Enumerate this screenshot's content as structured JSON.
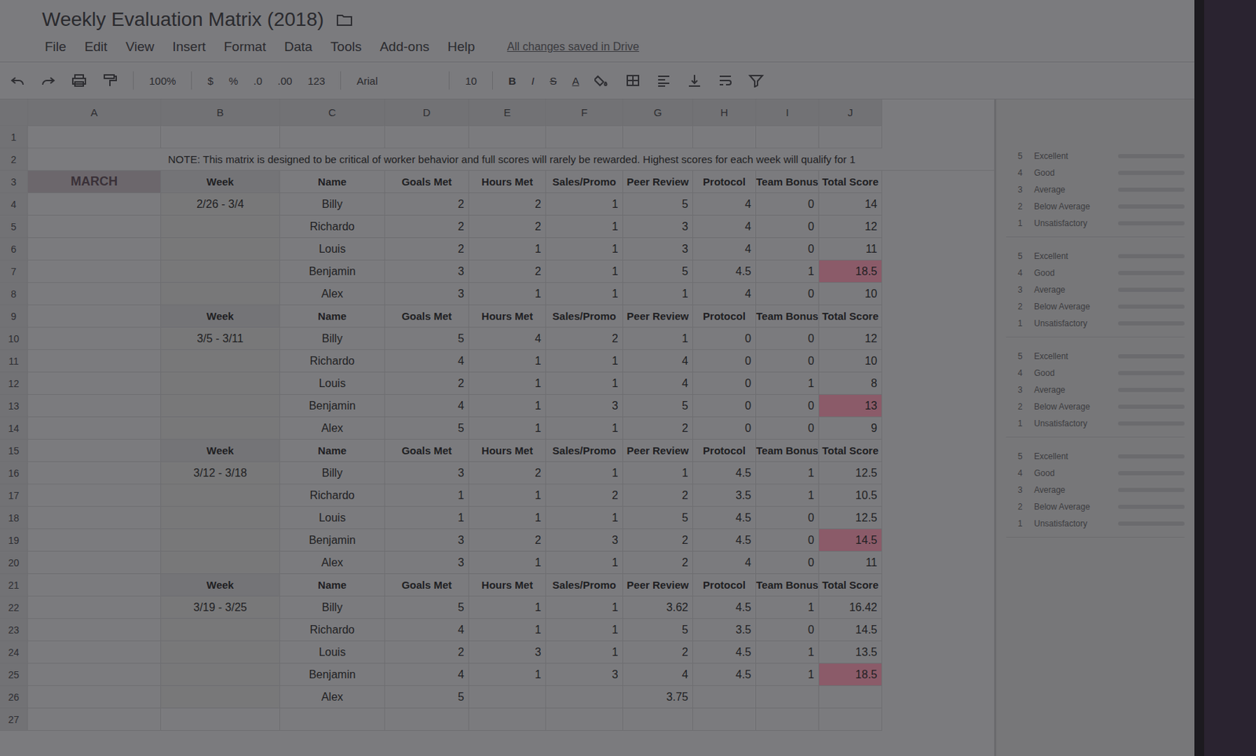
{
  "document": {
    "title": "Weekly Evaluation Matrix (2018)",
    "save_status": "All changes saved in Drive"
  },
  "menu": [
    "File",
    "Edit",
    "View",
    "Insert",
    "Format",
    "Data",
    "Tools",
    "Add-ons",
    "Help"
  ],
  "toolbar": {
    "zoom": "100%",
    "currency": "$",
    "percent": "%",
    "dec_less": ".0",
    "dec_more": ".00",
    "format": "123",
    "font": "Arial",
    "size": "10",
    "bold": "B",
    "italic": "I",
    "strike": "S",
    "color": "A"
  },
  "columns": [
    "A",
    "B",
    "C",
    "D",
    "E",
    "F",
    "G",
    "H",
    "I",
    "J"
  ],
  "row_numbers": [
    "1",
    "2",
    "3",
    "4",
    "5",
    "6",
    "7",
    "8",
    "9",
    "10",
    "11",
    "12",
    "13",
    "14",
    "15",
    "16",
    "17",
    "18",
    "19",
    "20",
    "21",
    "22",
    "23",
    "24",
    "25",
    "26",
    "27"
  ],
  "note": "NOTE: This matrix is designed to be critical of worker behavior and full scores will rarely be rewarded. Highest scores for each week will qualify for 1",
  "month": "MARCH",
  "weeks": [
    {
      "label": "Week",
      "dates": "2/26 - 3/4",
      "name_header": "Name",
      "headers": [
        "Goals Met",
        "Hours Met",
        "Sales/Promo",
        "Peer Review",
        "Protocol",
        "Team Bonus",
        "Total Score"
      ],
      "rows": [
        {
          "name": "Billy",
          "values": [
            "2",
            "2",
            "1",
            "5",
            "4",
            "0",
            "14"
          ],
          "highlighted": false
        },
        {
          "name": "Richardo",
          "values": [
            "2",
            "2",
            "1",
            "3",
            "4",
            "0",
            "12"
          ],
          "highlighted": false
        },
        {
          "name": "Louis",
          "values": [
            "2",
            "1",
            "1",
            "3",
            "4",
            "0",
            "11"
          ],
          "highlighted": false
        },
        {
          "name": "Benjamin",
          "values": [
            "3",
            "2",
            "1",
            "5",
            "4.5",
            "1",
            "18.5"
          ],
          "highlighted": true
        },
        {
          "name": "Alex",
          "values": [
            "3",
            "1",
            "1",
            "1",
            "4",
            "0",
            "10"
          ],
          "highlighted": false
        }
      ]
    },
    {
      "label": "Week",
      "dates": "3/5 - 3/11",
      "name_header": "Name",
      "headers": [
        "Goals Met",
        "Hours Met",
        "Sales/Promo",
        "Peer Review",
        "Protocol",
        "Team Bonus",
        "Total Score"
      ],
      "rows": [
        {
          "name": "Billy",
          "values": [
            "5",
            "4",
            "2",
            "1",
            "0",
            "0",
            "12"
          ],
          "highlighted": false
        },
        {
          "name": "Richardo",
          "values": [
            "4",
            "1",
            "1",
            "4",
            "0",
            "0",
            "10"
          ],
          "highlighted": false
        },
        {
          "name": "Louis",
          "values": [
            "2",
            "1",
            "1",
            "4",
            "0",
            "1",
            "8"
          ],
          "highlighted": false
        },
        {
          "name": "Benjamin",
          "values": [
            "4",
            "1",
            "3",
            "5",
            "0",
            "0",
            "13"
          ],
          "highlighted": true
        },
        {
          "name": "Alex",
          "values": [
            "5",
            "1",
            "1",
            "2",
            "0",
            "0",
            "9"
          ],
          "highlighted": false
        }
      ]
    },
    {
      "label": "Week",
      "dates": "3/12 - 3/18",
      "name_header": "Name",
      "headers": [
        "Goals Met",
        "Hours Met",
        "Sales/Promo",
        "Peer Review",
        "Protocol",
        "Team Bonus",
        "Total Score"
      ],
      "rows": [
        {
          "name": "Billy",
          "values": [
            "3",
            "2",
            "1",
            "1",
            "4.5",
            "1",
            "12.5"
          ],
          "highlighted": false
        },
        {
          "name": "Richardo",
          "values": [
            "1",
            "1",
            "2",
            "2",
            "3.5",
            "1",
            "10.5"
          ],
          "highlighted": false
        },
        {
          "name": "Louis",
          "values": [
            "1",
            "1",
            "1",
            "5",
            "4.5",
            "0",
            "12.5"
          ],
          "highlighted": false
        },
        {
          "name": "Benjamin",
          "values": [
            "3",
            "2",
            "3",
            "2",
            "4.5",
            "0",
            "14.5"
          ],
          "highlighted": true
        },
        {
          "name": "Alex",
          "values": [
            "3",
            "1",
            "1",
            "2",
            "4",
            "0",
            "11"
          ],
          "highlighted": false
        }
      ]
    },
    {
      "label": "Week",
      "dates": "3/19 - 3/25",
      "name_header": "Name",
      "headers": [
        "Goals Met",
        "Hours Met",
        "Sales/Promo",
        "Peer Review",
        "Protocol",
        "Team Bonus",
        "Total Score"
      ],
      "rows": [
        {
          "name": "Billy",
          "values": [
            "5",
            "1",
            "1",
            "3.62",
            "4.5",
            "1",
            "16.42"
          ],
          "highlighted": false
        },
        {
          "name": "Richardo",
          "values": [
            "4",
            "1",
            "1",
            "5",
            "3.5",
            "0",
            "14.5"
          ],
          "highlighted": false
        },
        {
          "name": "Louis",
          "values": [
            "2",
            "3",
            "1",
            "2",
            "4.5",
            "1",
            "13.5"
          ],
          "highlighted": false
        },
        {
          "name": "Benjamin",
          "values": [
            "4",
            "1",
            "3",
            "4",
            "4.5",
            "1",
            "18.5"
          ],
          "highlighted": true
        },
        {
          "name": "Alex",
          "values": [
            "5",
            "",
            "",
            "3.75",
            "",
            "",
            ""
          ],
          "highlighted": false
        }
      ]
    }
  ],
  "legend": [
    {
      "entries": [
        {
          "score": "5",
          "label": "Excellent"
        },
        {
          "score": "4",
          "label": "Good"
        },
        {
          "score": "3",
          "label": "Average"
        },
        {
          "score": "2",
          "label": "Below Average"
        },
        {
          "score": "1",
          "label": "Unsatisfactory"
        }
      ]
    },
    {
      "entries": [
        {
          "score": "5",
          "label": "Excellent"
        },
        {
          "score": "4",
          "label": "Good"
        },
        {
          "score": "3",
          "label": "Average"
        },
        {
          "score": "2",
          "label": "Below Average"
        },
        {
          "score": "1",
          "label": "Unsatisfactory"
        }
      ]
    },
    {
      "entries": [
        {
          "score": "5",
          "label": "Excellent"
        },
        {
          "score": "4",
          "label": "Good"
        },
        {
          "score": "3",
          "label": "Average"
        },
        {
          "score": "2",
          "label": "Below Average"
        },
        {
          "score": "1",
          "label": "Unsatisfactory"
        }
      ]
    },
    {
      "entries": [
        {
          "score": "5",
          "label": "Excellent"
        },
        {
          "score": "4",
          "label": "Good"
        },
        {
          "score": "3",
          "label": "Average"
        },
        {
          "score": "2",
          "label": "Below Average"
        },
        {
          "score": "1",
          "label": "Unsatisfactory"
        }
      ]
    }
  ]
}
